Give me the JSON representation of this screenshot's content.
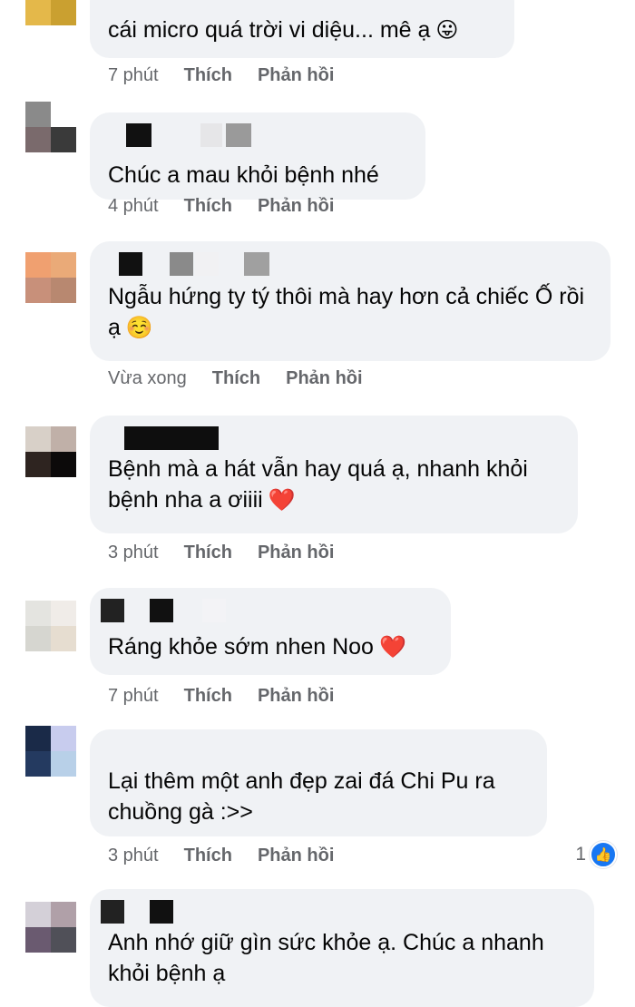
{
  "comments": [
    {
      "text": "cái micro quá trời vi diệu... mê ạ",
      "emoji": "😛",
      "time": "7 phút",
      "like_label": "Thích",
      "reply_label": "Phản hồi"
    },
    {
      "text": "Chúc a  mau khỏi bệnh nhé",
      "time": "4 phút",
      "like_label": "Thích",
      "reply_label": "Phản hồi"
    },
    {
      "text": "Ngẫu hứng ty tý thôi mà hay hơn cả chiếc Ố rồi ạ",
      "emoji": "☺️",
      "time": "Vừa xong",
      "like_label": "Thích",
      "reply_label": "Phản hồi"
    },
    {
      "text": "Bệnh mà a hát vẫn hay quá ạ, nhanh khỏi bệnh nha a ơiiii",
      "emoji": "❤️",
      "time": "3 phút",
      "like_label": "Thích",
      "reply_label": "Phản hồi"
    },
    {
      "text": "Ráng khỏe sớm nhen Noo",
      "emoji": "❤️",
      "time": "7 phút",
      "like_label": "Thích",
      "reply_label": "Phản hồi"
    },
    {
      "text": "Lại thêm một anh đẹp zai đá Chi Pu ra chuồng gà :>>",
      "time": "3 phút",
      "like_label": "Thích",
      "reply_label": "Phản hồi",
      "reaction_count": "1",
      "reaction_icon": "like-icon"
    },
    {
      "text": "Anh nhớ giữ gìn sức khỏe ạ. Chúc a nhanh khỏi bệnh ạ"
    }
  ],
  "colors": {
    "bubble": "#f0f2f5",
    "meta_text": "#65676b",
    "like_blue": "#1877f2"
  }
}
